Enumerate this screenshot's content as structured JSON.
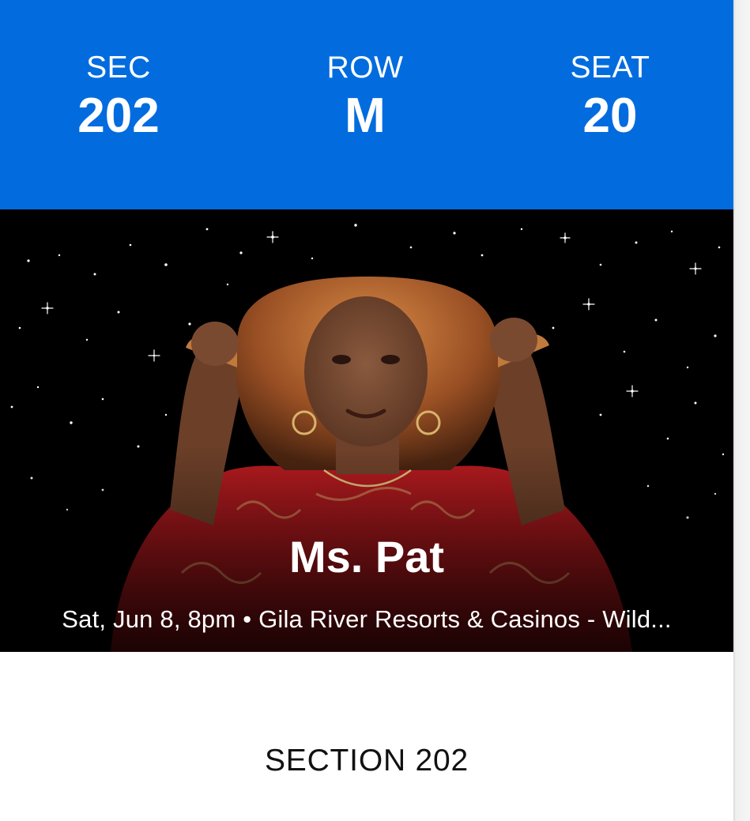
{
  "ticket": {
    "sec_label": "SEC",
    "sec_value": "202",
    "row_label": "ROW",
    "row_value": "M",
    "seat_label": "SEAT",
    "seat_value": "20"
  },
  "event": {
    "title": "Ms. Pat",
    "meta": "Sat, Jun 8, 8pm • Gila River Resorts & Casinos - Wild..."
  },
  "section": {
    "title": "SECTION 202"
  },
  "colors": {
    "header_bg": "#026cdf",
    "hero_bg": "#000000"
  }
}
